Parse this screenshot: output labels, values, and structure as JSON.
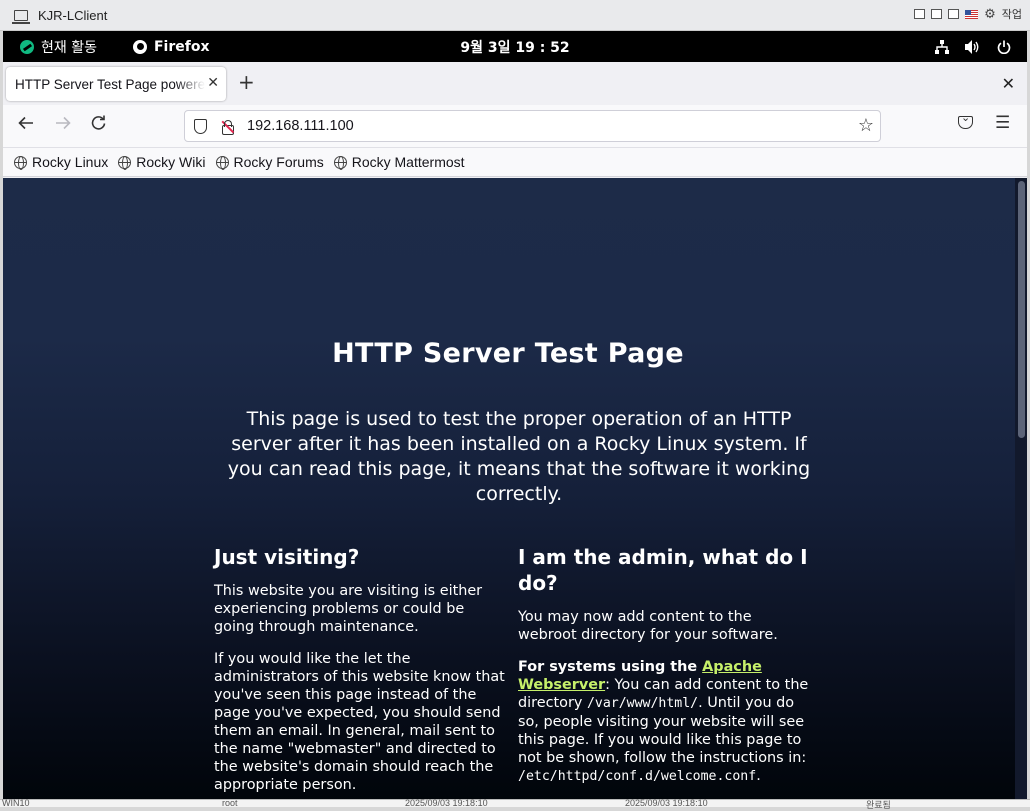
{
  "vm": {
    "title": "KJR-LClient",
    "work_label": "작업"
  },
  "gnome": {
    "activities": "현재 활동",
    "app_name": "Firefox",
    "clock": "9월 3일  19 : 52"
  },
  "browser": {
    "tab_title": "HTTP Server Test Page powered by Rocky Linux",
    "tab_close": "✕",
    "new_tab": "+",
    "window_close": "✕",
    "url": "192.168.111.100",
    "bookmarks": [
      "Rocky Linux",
      "Rocky Wiki",
      "Rocky Forums",
      "Rocky Mattermost"
    ]
  },
  "page": {
    "title_part1": "HTTP Server",
    "title_part2": "Test Page",
    "intro": "This page is used to test the proper operation of an HTTP server after it has been installed on a Rocky Linux system. If you can read this page, it means that the software it working correctly.",
    "visiting": {
      "heading": "Just visiting?",
      "p1": "This website you are visiting is either experiencing problems or could be going through maintenance.",
      "p2": "If you would like the let the administrators of this website know that you've seen this page instead of the page you've expected, you should send them an email. In general, mail sent to the name \"webmaster\" and directed to the website's domain should reach the appropriate person."
    },
    "admin": {
      "heading": "I am the admin, what do I do?",
      "p1": "You may now add content to the webroot directory for your software.",
      "lead": "For systems using the ",
      "link": "Apache Webserver",
      "p2a": ": You can add content to the directory ",
      "code1": "/var/www/html/",
      "p2b": ". Until you do so, people visiting your website will see this page. If you would like this page to not be shown, follow the instructions in: ",
      "code2": "/etc/httpd/conf.d/welcome.conf",
      "p2c": "."
    }
  },
  "host_bottom": {
    "c1": "WIN10",
    "c2": "root",
    "c3": "2025/09/03 19:18:10",
    "c4": "2025/09/03 19:18:10",
    "c5": "완료됨"
  }
}
